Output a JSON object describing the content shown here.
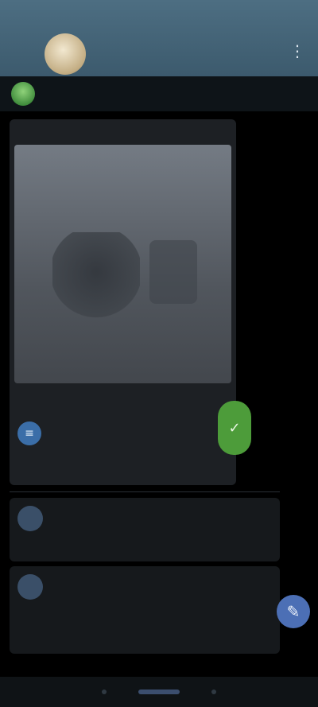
{
  "status": {
    "time": "",
    "signal": "",
    "battery": ""
  },
  "chat": {
    "title": "",
    "subtitle": "",
    "menu_icon": "more-vert-icon"
  },
  "subheader": {
    "title": "",
    "count": ""
  },
  "post": {
    "author": "",
    "tag": "",
    "caption": "",
    "views": "",
    "time": ""
  },
  "file": {
    "icon": "document-icon",
    "name": "",
    "size": ""
  },
  "link": {
    "text": ""
  },
  "badge": {
    "icon": "check-icon",
    "symbol": "✓"
  },
  "messages": [
    {
      "author": "",
      "tag": "",
      "text": "",
      "time": "",
      "avatar_initial": "",
      "avatar_icon": "avatar-icon"
    },
    {
      "author": "",
      "tag": "",
      "text": "",
      "time": "",
      "avatar_initial": "",
      "avatar_icon": "avatar-icon"
    }
  ],
  "fab": {
    "icon": "edit-icon",
    "symbol": "✎"
  },
  "colors": {
    "topbar": "#476879",
    "accent_green": "#4d9c3a",
    "accent_blue": "#4c6fb5",
    "background": "#000000"
  }
}
